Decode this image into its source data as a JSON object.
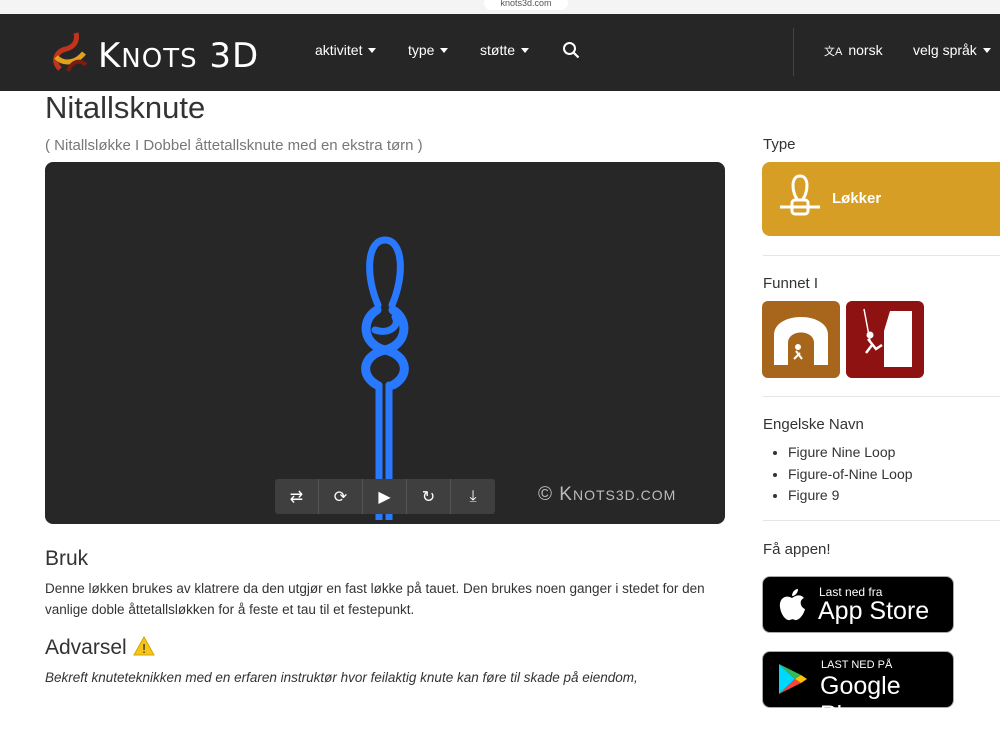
{
  "browser": {
    "url": "knots3d.com"
  },
  "nav": {
    "brand_prefix": "K",
    "brand_mid": "NOTS",
    "brand_num": "3D",
    "menu": [
      {
        "label": "aktivitet"
      },
      {
        "label": "type"
      },
      {
        "label": "støtte"
      }
    ],
    "lang_current": "norsk",
    "lang_select": "velg språk"
  },
  "page": {
    "title": "Nitallsknute",
    "subtitle": "( Nitallsløkke I Dobbel åttetallsknute med en ekstra tørn )"
  },
  "viewer": {
    "watermark_main": "© K",
    "watermark_small": "NOTS3D.COM",
    "controls": [
      {
        "icon": "swap-arrows-icon",
        "glyph": "⇄"
      },
      {
        "icon": "rotate-icon",
        "glyph": "⟳"
      },
      {
        "icon": "play-icon",
        "glyph": "▶"
      },
      {
        "icon": "loop-icon",
        "glyph": "↻"
      },
      {
        "icon": "download-icon",
        "glyph": "⤓"
      }
    ],
    "rope_color": "#2979ff"
  },
  "sections": {
    "usage_heading": "Bruk",
    "usage_text": "Denne løkken brukes av klatrere da den utgjør en fast løkke på tauet. Den brukes noen ganger i stedet for den vanlige doble åttetallsløkken for å feste et tau til et festepunkt.",
    "warning_heading": "Advarsel",
    "warning_text": "Bekreft knuteteknikken med en erfaren instruktør hvor feilaktig knute kan føre til skade på eiendom,"
  },
  "sidebar": {
    "type_heading": "Type",
    "type_label": "Løkker",
    "type_color": "#d69e24",
    "found_heading": "Funnet I",
    "found_colors": [
      "#a8661c",
      "#8e1212"
    ],
    "english_heading": "Engelske Navn",
    "english_names": [
      "Figure Nine Loop",
      "Figure-of-Nine Loop",
      "Figure 9"
    ],
    "app_heading": "Få appen!",
    "appstore_small": "Last ned fra",
    "appstore_big": "App Store",
    "googleplay_small": "LAST NED PÅ",
    "googleplay_big": "Google Play"
  }
}
